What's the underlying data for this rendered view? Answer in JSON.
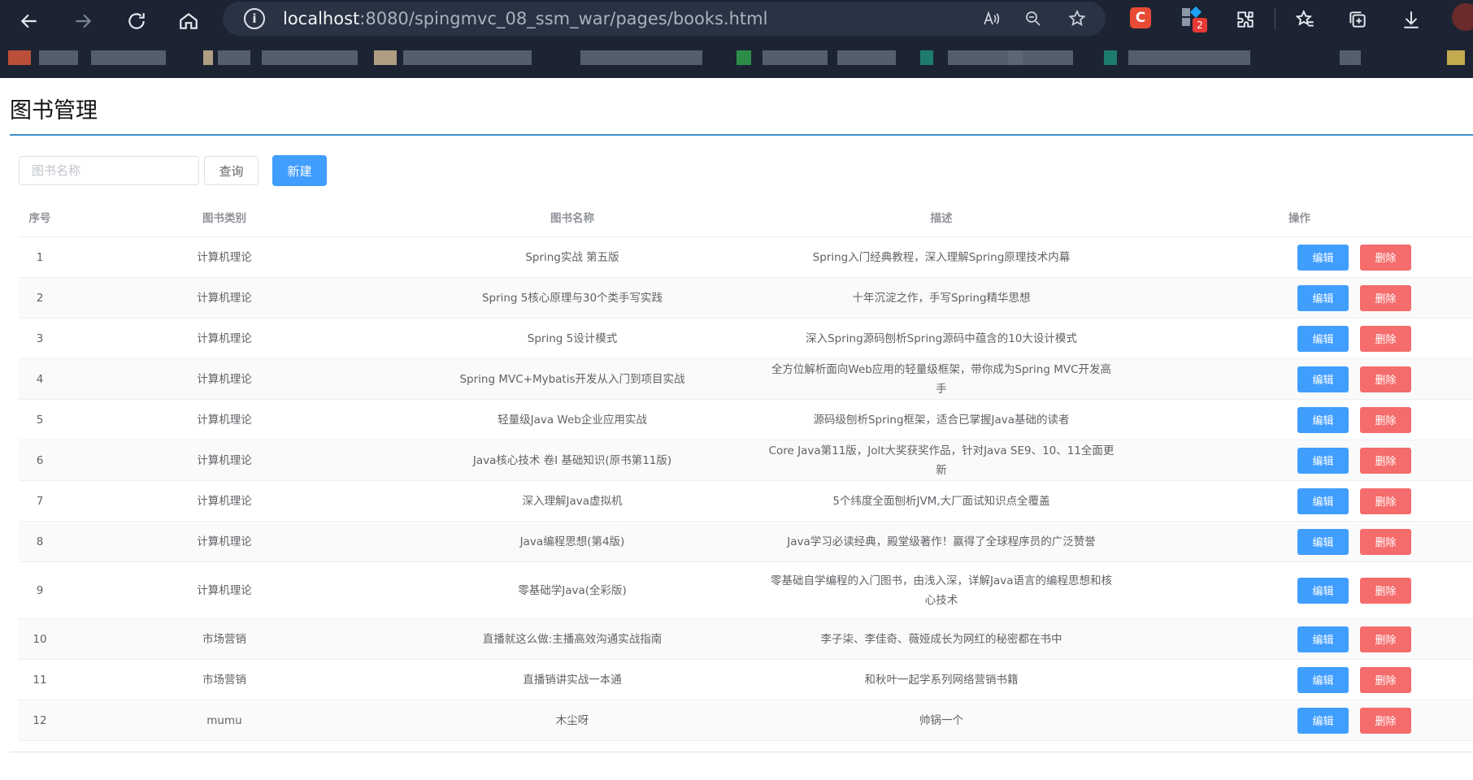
{
  "browser": {
    "url_host": "localhost",
    "url_rest": ":8080/spingmvc_08_ssm_war/pages/books.html",
    "extension_letter": "C",
    "extension_badge": "2",
    "colors": {
      "chrome_bg": "#1c2433",
      "address_bg": "#2a3343"
    }
  },
  "page": {
    "title": "图书管理",
    "search": {
      "placeholder": "图书名称",
      "value": ""
    },
    "query_label": "查询",
    "new_label": "新建"
  },
  "table": {
    "headers": {
      "index": "序号",
      "category": "图书类别",
      "name": "图书名称",
      "description": "描述",
      "actions": "操作"
    },
    "edit_label": "编辑",
    "delete_label": "删除",
    "rows": [
      {
        "index": "1",
        "category": "计算机理论",
        "name": "Spring实战 第五版",
        "description": "Spring入门经典教程，深入理解Spring原理技术内幕"
      },
      {
        "index": "2",
        "category": "计算机理论",
        "name": "Spring 5核心原理与30个类手写实践",
        "description": "十年沉淀之作，手写Spring精华思想"
      },
      {
        "index": "3",
        "category": "计算机理论",
        "name": "Spring 5设计模式",
        "description": "深入Spring源码刨析Spring源码中蕴含的10大设计模式"
      },
      {
        "index": "4",
        "category": "计算机理论",
        "name": "Spring MVC+Mybatis开发从入门到项目实战",
        "description": "全方位解析面向Web应用的轻量级框架，带你成为Spring MVC开发高手"
      },
      {
        "index": "5",
        "category": "计算机理论",
        "name": "轻量级Java Web企业应用实战",
        "description": "源码级刨析Spring框架，适合已掌握Java基础的读者"
      },
      {
        "index": "6",
        "category": "计算机理论",
        "name": "Java核心技术 卷Ⅰ 基础知识(原书第11版)",
        "description": "Core Java第11版，Jolt大奖获奖作品，针对Java SE9、10、11全面更新"
      },
      {
        "index": "7",
        "category": "计算机理论",
        "name": "深入理解Java虚拟机",
        "description": "5个纬度全面刨析JVM,大厂面试知识点全覆盖"
      },
      {
        "index": "8",
        "category": "计算机理论",
        "name": "Java编程思想(第4版)",
        "description": "Java学习必读经典，殿堂级著作！赢得了全球程序员的广泛赞誉"
      },
      {
        "index": "9",
        "category": "计算机理论",
        "name": "零基础学Java(全彩版)",
        "description": "零基础自学编程的入门图书，由浅入深，详解Java语言的编程思想和核心技术"
      },
      {
        "index": "10",
        "category": "市场营销",
        "name": "直播就这么做:主播高效沟通实战指南",
        "description": "李子柒、李佳奇、薇娅成长为网红的秘密都在书中"
      },
      {
        "index": "11",
        "category": "市场营销",
        "name": "直播销讲实战一本通",
        "description": "和秋叶一起学系列网络营销书籍"
      },
      {
        "index": "12",
        "category": "mumu",
        "name": "木尘呀",
        "description": "帅锅一个"
      }
    ]
  },
  "colors": {
    "primary": "#409eff",
    "danger": "#f56c6c",
    "title_line": "#3a8ec6"
  }
}
